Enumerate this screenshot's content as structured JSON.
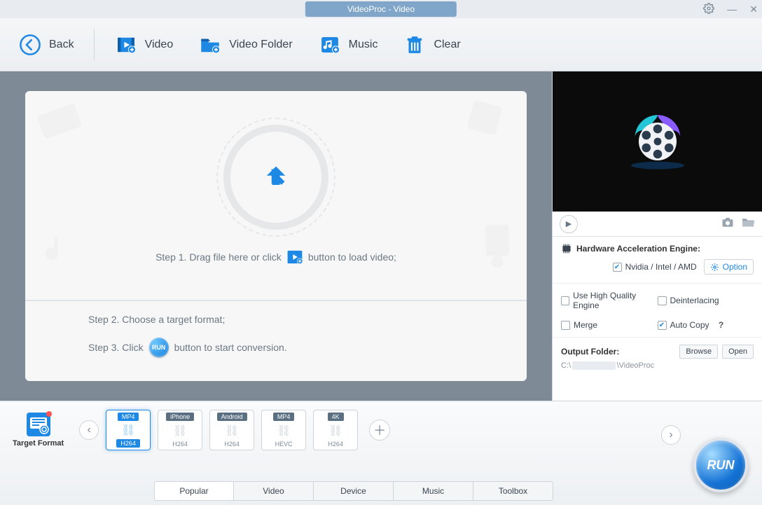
{
  "app": {
    "title": "VideoProc - Video"
  },
  "toolbar": {
    "back": "Back",
    "video": "Video",
    "video_folder": "Video Folder",
    "music": "Music",
    "clear": "Clear"
  },
  "stage": {
    "step1_a": "Step 1. Drag file here or click",
    "step1_b": "button to load video;",
    "step2": "Step 2. Choose a target format;",
    "step3_a": "Step 3. Click",
    "step3_b": "button to start conversion.",
    "run_label": "RUN"
  },
  "right": {
    "hwaccel_title": "Hardware Acceleration Engine:",
    "gpu_label": "Nvidia / Intel / AMD",
    "gpu_checked": true,
    "option_btn": "Option",
    "use_hq": "Use High Quality Engine",
    "use_hq_checked": false,
    "deinterlace": "Deinterlacing",
    "deinterlace_checked": false,
    "merge": "Merge",
    "merge_checked": false,
    "autocopy": "Auto Copy",
    "autocopy_checked": true,
    "autocopy_help": "?",
    "output_folder_label": "Output Folder:",
    "browse": "Browse",
    "open": "Open",
    "path_prefix": "C:\\",
    "path_suffix": "\\VideoProc"
  },
  "bottom": {
    "target_format": "Target Format",
    "formats": [
      {
        "top": "MP4",
        "bot": "H264",
        "active": true
      },
      {
        "top": "iPhone",
        "bot": "H264",
        "active": false
      },
      {
        "top": "Android",
        "bot": "H264",
        "active": false
      },
      {
        "top": "MP4",
        "bot": "HEVC",
        "active": false
      },
      {
        "top": "4K",
        "bot": "H264",
        "active": false
      }
    ],
    "tabs": [
      "Popular",
      "Video",
      "Device",
      "Music",
      "Toolbox"
    ],
    "active_tab": "Popular",
    "run": "RUN"
  }
}
